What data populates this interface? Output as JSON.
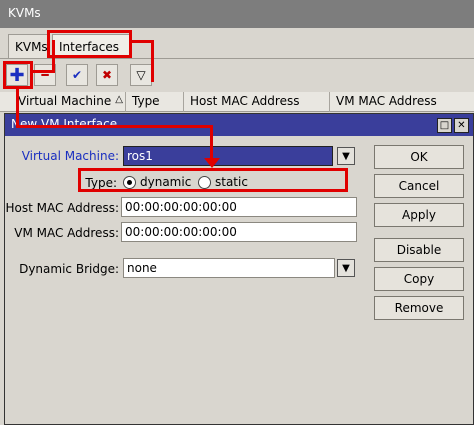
{
  "window": {
    "title": "KVMs"
  },
  "tabs": [
    {
      "label": "KVMs"
    },
    {
      "label": "Interfaces"
    }
  ],
  "toolbar": {
    "add_icon": "plus-icon",
    "remove_icon": "minus-icon",
    "enable_icon": "check-icon",
    "disable_icon": "x-icon",
    "filter_icon": "filter-icon"
  },
  "table": {
    "columns": [
      "Virtual Machine",
      "Type",
      "Host MAC Address",
      "VM MAC Address"
    ]
  },
  "dialog": {
    "title": "New VM Interface",
    "virtual_machine_label": "Virtual Machine:",
    "virtual_machine_value": "ros1",
    "type_label": "Type:",
    "type_dynamic": "dynamic",
    "type_static": "static",
    "host_mac_label": "Host MAC Address:",
    "host_mac_value": "00:00:00:00:00:00",
    "vm_mac_label": "VM MAC Address:",
    "vm_mac_value": "00:00:00:00:00:00",
    "bridge_label": "Dynamic Bridge:",
    "bridge_value": "none",
    "buttons": {
      "ok": "OK",
      "cancel": "Cancel",
      "apply": "Apply",
      "disable": "Disable",
      "copy": "Copy",
      "remove": "Remove"
    }
  },
  "annotation_color": "#e00000"
}
